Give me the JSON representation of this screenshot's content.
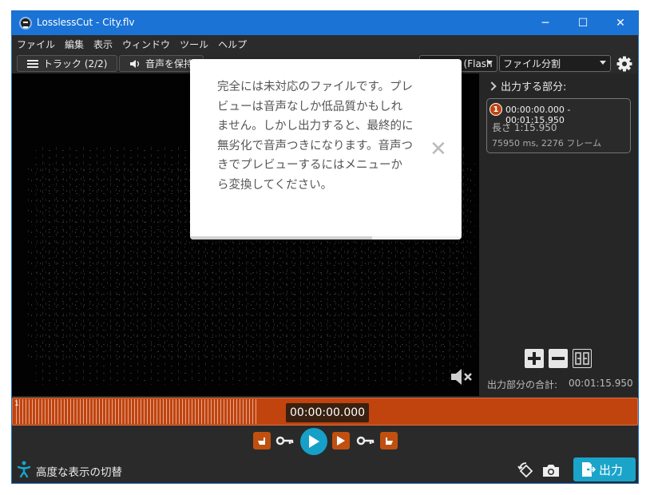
{
  "window": {
    "title": "LosslessCut - City.flv",
    "controls": {
      "minimize": "─",
      "maximize": "☐",
      "close": "✕"
    }
  },
  "menu": [
    "ファイル",
    "編集",
    "表示",
    "ウィンドウ",
    "ツール",
    "ヘルプ"
  ],
  "toolbar": {
    "tracks_label": "トラック (2/2)",
    "audio_label": "音声を保持",
    "format_value": "Preview (Flash",
    "mode_value": "ファイル分割"
  },
  "dialog": {
    "message": "完全には未対応のファイルです。プレビューは音声なしか低品質かもしれません。しかし出力すると、最終的に無劣化で音声つきになります。音声つきでプレビューするにはメニューから変換してください。",
    "close_glyph": "✕",
    "progress": 0.67
  },
  "segments_panel": {
    "header": "出力する部分:",
    "segment": {
      "number": "1",
      "range": "00:00:00.000 - 00:01:15.950",
      "length": "長さ 1:15.950",
      "details": "75950 ms, 2276 フレーム"
    },
    "total_label": "出力部分の合計:",
    "total_value": "00:01:15.950"
  },
  "timeline": {
    "current_time": "00:00:00.000",
    "segment_number": "1"
  },
  "bottom": {
    "advanced_label": "高度な表示の切替",
    "export_label": "出力"
  },
  "colors": {
    "accent": "#1ba4c9",
    "segment": "#c1430e",
    "titlebar": "#1b73d6"
  }
}
